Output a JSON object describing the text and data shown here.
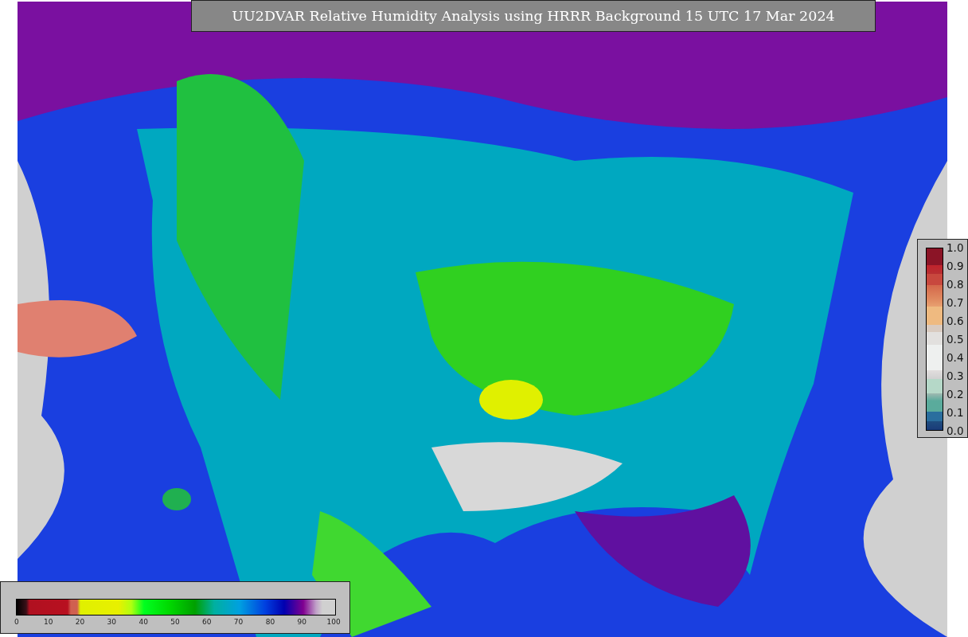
{
  "title": "UU2DVAR Relative Humidity Analysis using HRRR Background 15 UTC 17 Mar 2024",
  "side_colorbar": {
    "ticks": [
      "1.0",
      "0.9",
      "0.8",
      "0.7",
      "0.6",
      "0.5",
      "0.4",
      "0.3",
      "0.2",
      "0.1",
      "0.0"
    ]
  },
  "bottom_colorbar": {
    "ticks": [
      "0",
      "10",
      "20",
      "30",
      "40",
      "50",
      "60",
      "70",
      "80",
      "90",
      "100"
    ]
  }
}
